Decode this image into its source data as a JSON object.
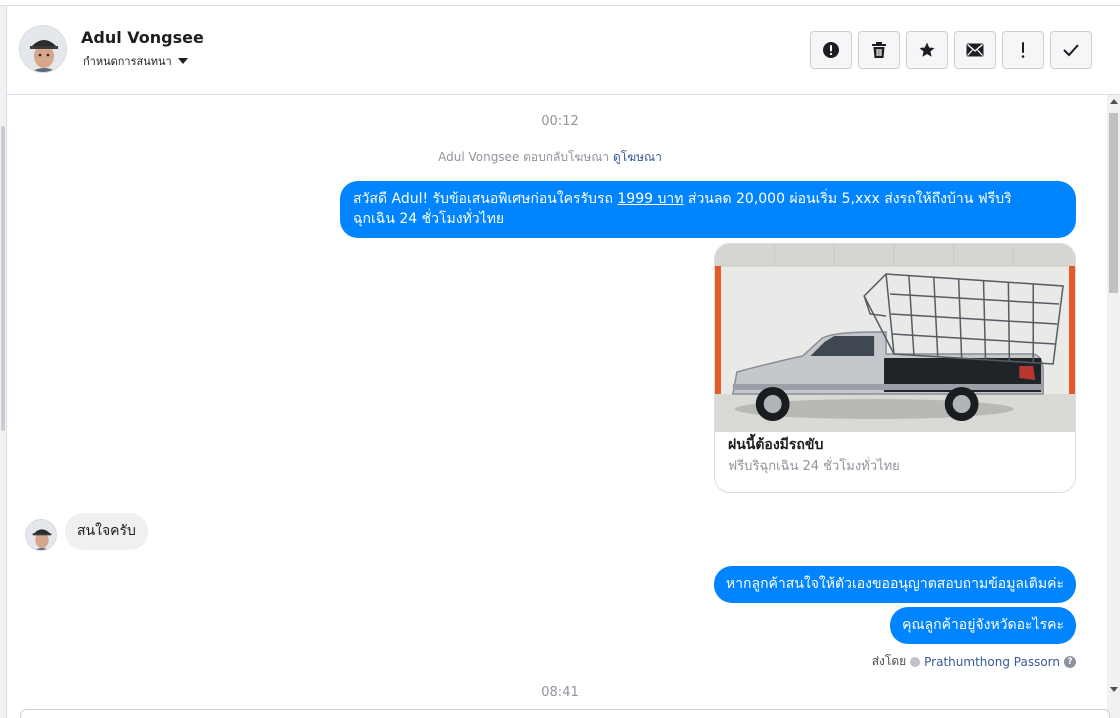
{
  "header": {
    "contact_name": "Adul Vongsee",
    "label_select": "กำหนดการสนทนา",
    "actions": [
      {
        "name": "report",
        "icon": "alert-circle-icon",
        "glyph": "!"
      },
      {
        "name": "delete",
        "icon": "trash-icon"
      },
      {
        "name": "star",
        "icon": "star-icon"
      },
      {
        "name": "mark-unread",
        "icon": "envelope-icon"
      },
      {
        "name": "important",
        "icon": "exclamation-icon",
        "glyph": "!"
      },
      {
        "name": "done",
        "icon": "check-icon"
      }
    ]
  },
  "conversation": {
    "timestamp_top": "00:12",
    "reply_note": {
      "text": "Adul Vongsee ตอบกลับโฆษณา",
      "link": "ดูโฆษณา"
    },
    "outgoing_message_1": {
      "part1": "สวัสดี Adul! รับข้อเสนอพิเศษก่อนใครรับรถ ",
      "underlined": "1999 บาท",
      "part2": " ส่วนลด 20,000  ผ่อนเริ่ม 5,xxx ส่งรถให้ถึงบ้าน ฟรีบริ",
      "line2": "ฉุกเฉิน 24 ชั่วโมงทั่วไทย"
    },
    "ad_card": {
      "title": "ฝนนี้ต้องมีรถขับ",
      "subtitle": "ฟรีบริฉุกเฉิน 24 ชั่วโมงทั่วไทย"
    },
    "incoming_message": "สนใจครับ",
    "outgoing_message_2": "หากลูกค้าสนใจให้ตัวเองขออนุญาตสอบถามข้อมูลเติมค่ะ",
    "outgoing_message_3": "คุณลูกค้าอยู่จังหวัดอะไรคะ",
    "sent_by": {
      "prefix": "ส่งโดย",
      "name": "Prathumthong Passorn",
      "help": "?"
    },
    "timestamp_bottom": "08:41"
  },
  "colors": {
    "accent": "#0084ff",
    "incoming_bubble": "#f1f0f0",
    "link": "#385898"
  }
}
